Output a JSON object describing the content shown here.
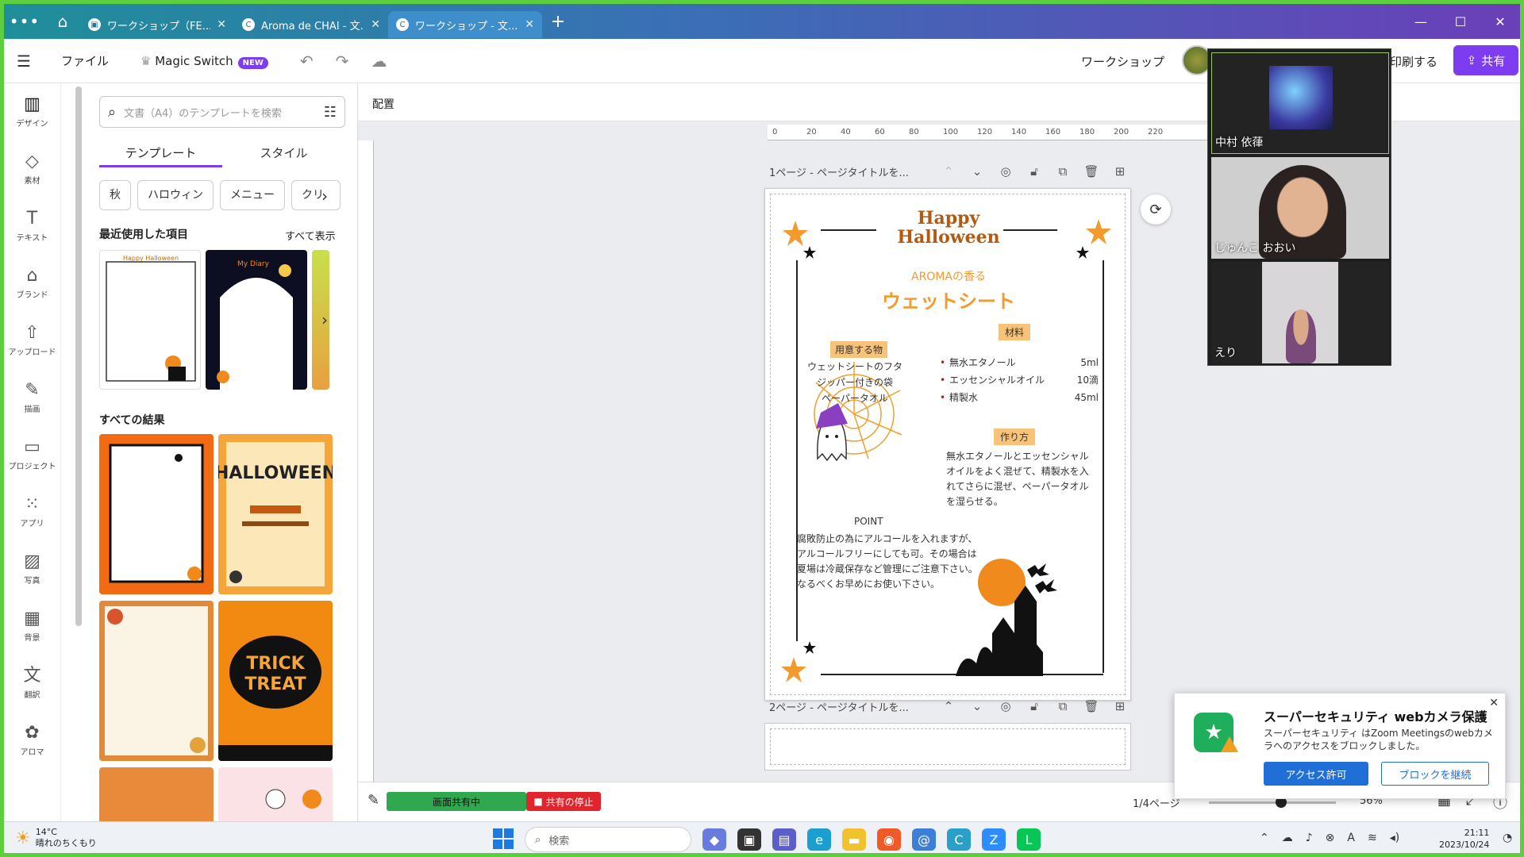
{
  "browser": {
    "tabs": [
      {
        "label": "ワークショップ（FE...",
        "active": false
      },
      {
        "label": "Aroma de CHAI - 文...",
        "active": false
      },
      {
        "label": "ワークショップ - 文...",
        "active": true
      }
    ]
  },
  "toolbar": {
    "file": "ファイル",
    "magic_switch": "Magic Switch",
    "new_badge": "NEW",
    "project_name": "ワークショップ",
    "print": "印刷する",
    "share": "共有"
  },
  "rail": [
    {
      "label": "デザイン",
      "icon": "layout-icon"
    },
    {
      "label": "素材",
      "icon": "elements-icon"
    },
    {
      "label": "テキスト",
      "icon": "text-icon"
    },
    {
      "label": "ブランド",
      "icon": "brand-icon"
    },
    {
      "label": "アップロード",
      "icon": "upload-icon"
    },
    {
      "label": "描画",
      "icon": "draw-icon"
    },
    {
      "label": "プロジェクト",
      "icon": "folder-icon"
    },
    {
      "label": "アプリ",
      "icon": "apps-icon"
    },
    {
      "label": "写真",
      "icon": "photo-icon"
    },
    {
      "label": "背景",
      "icon": "background-icon"
    },
    {
      "label": "翻訳",
      "icon": "translate-icon"
    },
    {
      "label": "アロマ",
      "icon": "aroma-icon"
    }
  ],
  "panel": {
    "search_placeholder": "文書（A4）のテンプレートを検索",
    "tab_templates": "テンプレート",
    "tab_styles": "スタイル",
    "chips": [
      "秋",
      "ハロウィン",
      "メニュー",
      "クリ"
    ],
    "recent_title": "最近使用した項目",
    "see_all": "すべて表示",
    "results_title": "すべての結果"
  },
  "canvas": {
    "subbar_label": "配置",
    "ruler_ticks": [
      "0",
      "20",
      "40",
      "60",
      "80",
      "100",
      "120",
      "140",
      "160",
      "180",
      "200",
      "220"
    ],
    "page1_title": "1ページ - ページタイトルを...",
    "page2_title": "2ページ - ページタイトルを..."
  },
  "flyer": {
    "title_line1": "Happy",
    "title_line2": "Halloween",
    "subtitle": "AROMAの香る",
    "heading": "ウェットシート",
    "materials_label": "材料",
    "prepare_label": "用意する物",
    "prepare_items": [
      "ウェットシートのフタ",
      "ジッパー付きの袋",
      "ペーパータオル"
    ],
    "materials": [
      {
        "name": "無水エタノール",
        "qty": "5ml"
      },
      {
        "name": "エッセンシャルオイル",
        "qty": "10滴"
      },
      {
        "name": "精製水",
        "qty": "45ml"
      }
    ],
    "method_label": "作り方",
    "method_text": "無水エタノールとエッセンシャルオイルをよく混ぜて、精製水を入れてさらに混ぜ、ペーパータオルを湿らせる。",
    "point_label": "POINT",
    "point_lines": [
      "腐敗防止の為にアルコールを入れますが、",
      "アルコールフリーにしても可。その場合は",
      "夏場は冷蔵保存など管理にご注意下さい。",
      "なるべくお早めにお使い下さい。"
    ]
  },
  "bottom": {
    "screen_sharing": "画面共有中",
    "stop_sharing": "共有の停止",
    "page_count": "1/4ページ",
    "zoom": "56%",
    "zoom_level": 0.56
  },
  "zoom_participants": [
    "中村 依葎",
    "じゅんこ おおい",
    "えり"
  ],
  "security_popup": {
    "title": "スーパーセキュリティ webカメラ保護",
    "message": "スーパーセキュリティ はZoom Meetingsのwebカメラへのアクセスをブロックしました。",
    "allow": "アクセス許可",
    "block": "ブロックを継続"
  },
  "taskbar": {
    "temperature": "14°C",
    "weather": "晴れのちくもり",
    "search": "検索",
    "time": "21:11",
    "date": "2023/10/24"
  },
  "colors": {
    "accent": "#7d3cf0",
    "halloween_orange": "#f39a2e",
    "share_green": "#2fa84f",
    "stop_red": "#e0252c"
  }
}
